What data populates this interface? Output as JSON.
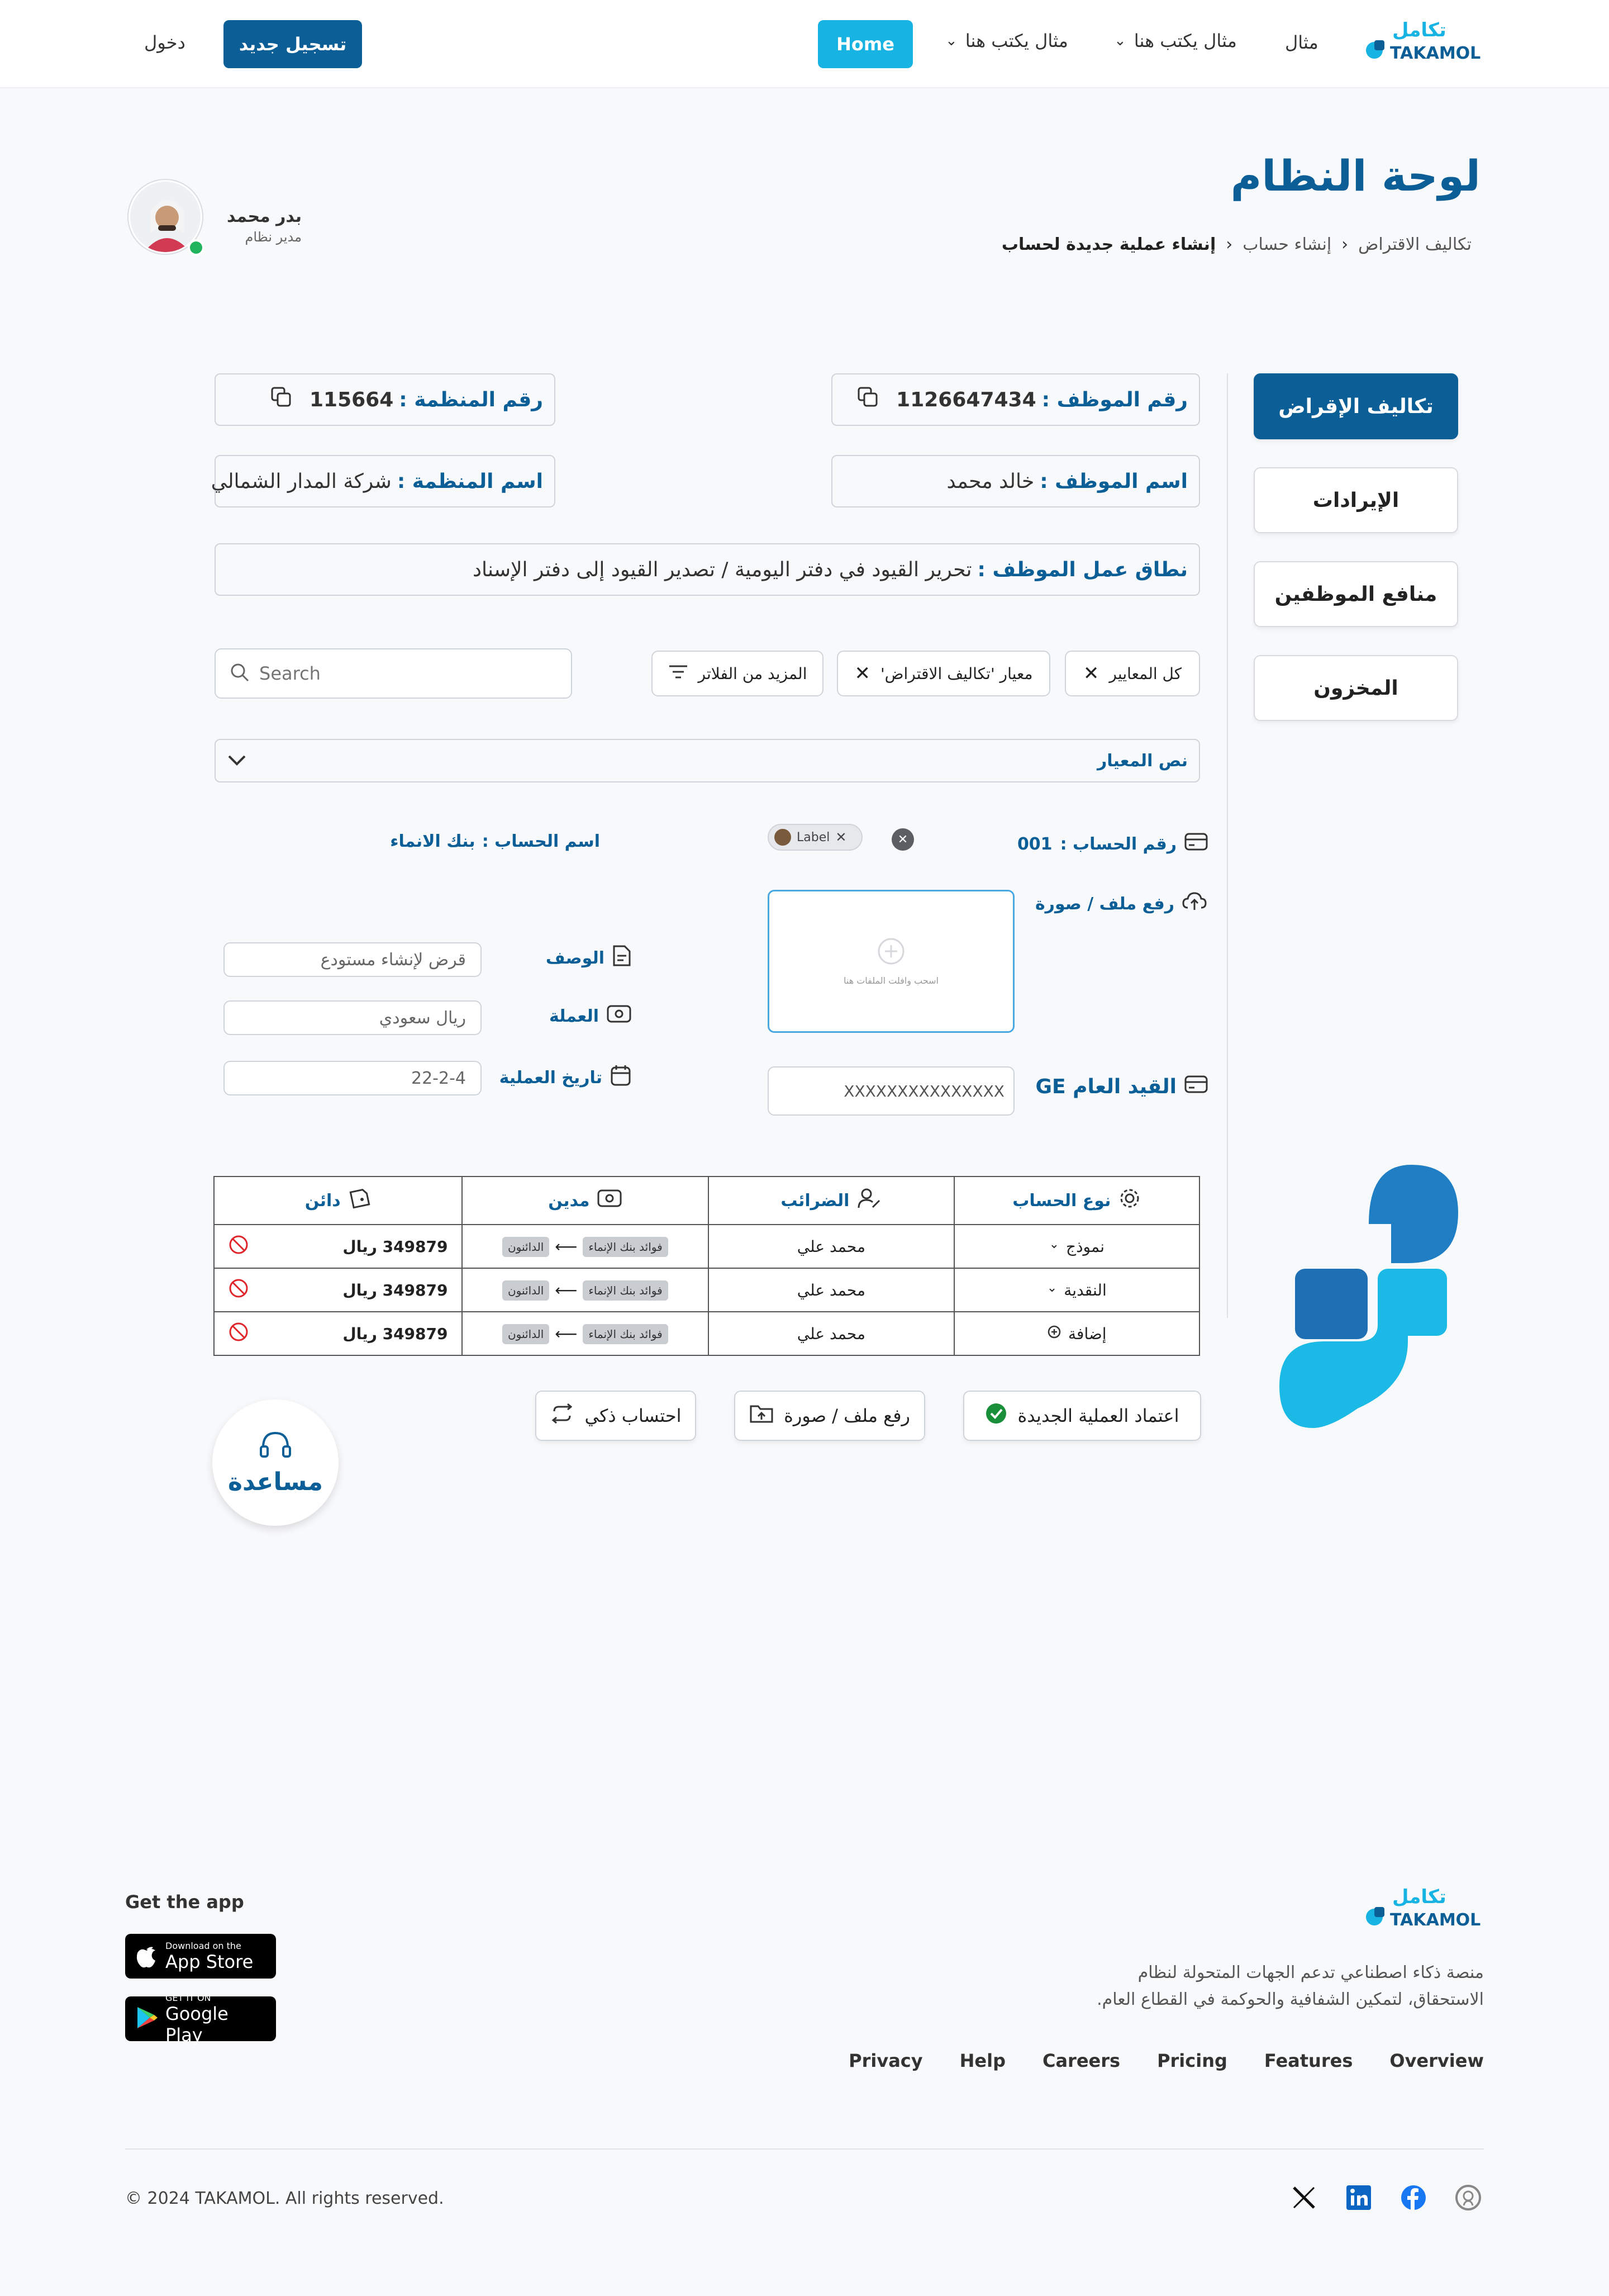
{
  "header": {
    "logo_ar": "تكامل",
    "logo_en": "TAKAMOL",
    "nav": [
      "مثال",
      "مثال يكتب هنا",
      "مثال يكتب هنا"
    ],
    "home": "Home",
    "register": "تسجيل جديد",
    "login": "دخول"
  },
  "page": {
    "title": "لوحة النظام",
    "breadcrumb": [
      "تكاليف الاقتراض",
      "إنشاء حساب",
      "إنشاء عملية جديدة لحساب"
    ]
  },
  "user": {
    "name": "بدر محمد",
    "role": "مدير نظام",
    "status_color": "#22b35e"
  },
  "sidebar": [
    "تكاليف الإقراض",
    "الإيرادات",
    "منافع الموظفين",
    "المخزون"
  ],
  "info": {
    "emp_no_label": "رقم الموظف :",
    "emp_no": "1126647434",
    "org_no_label": "رقم المنظمة :",
    "org_no": "115664",
    "emp_name_label": "اسم الموظف :",
    "emp_name": "خالد محمد",
    "org_name_label": "اسم المنظمة :",
    "org_name": "شركة المدار الشمالي",
    "scope_label": "نطاق عمل الموظف :",
    "scope": "تحرير القيود في دفتر اليومية / تصدير القيود إلى دفتر الإسناد"
  },
  "filters": {
    "all": "كل المعايير",
    "criterion": "معيار 'تكاليف الاقتراض'",
    "more": "المزيد من الفلاتر",
    "search_placeholder": "Search"
  },
  "criterion_text": "نص المعيار",
  "form": {
    "account_no_label": "رقم الحساب :",
    "account_no": "001",
    "tag_label": "Label",
    "account_name_label": "اسم  الحساب :",
    "account_name": "بنك الانماء",
    "upload_label": "رفع ملف / صورة",
    "upload_hint": "اسحب وافلت الملفات هنا",
    "desc_label": "الوصف",
    "desc_value": "قرض لإنشاء مستودع",
    "currency_label": "العملة",
    "currency_value": "ريال سعودي",
    "date_label": "تاريخ العملية",
    "date_value": "22-2-4",
    "ge_label": "القيد العام GE",
    "ge_value": "XXXXXXXXXXXXXXX"
  },
  "table": {
    "headers": [
      "نوع الحساب",
      "الضرائب",
      "مدين",
      "دائن"
    ],
    "rows": [
      {
        "type": "نموذج",
        "tax": "محمد علي",
        "debit_from": "الدائنون",
        "debit_to": "فوائد بنك الإنماء",
        "credit": "349879 ريال"
      },
      {
        "type": "النقدية",
        "tax": "محمد علي",
        "debit_from": "الدائنون",
        "debit_to": "فوائد بنك الإنماء",
        "credit": "349879 ريال"
      },
      {
        "type": "إضافة",
        "tax": "محمد علي",
        "debit_from": "الدائنون",
        "debit_to": "فوائد بنك الإنماء",
        "credit": "349879 ريال"
      }
    ]
  },
  "actions": {
    "approve": "اعتماد العملية الجديدة",
    "upload": "رفع ملف / صورة",
    "smart": "احتساب ذكي"
  },
  "help": "مساعدة",
  "footer": {
    "get_app": "Get the app",
    "appstore_small": "Download on the",
    "appstore": "App Store",
    "gplay_small": "GET IT ON",
    "gplay": "Google Play",
    "desc1": "منصة ذكاء اصطناعي تدعم الجهات المتحولة لنظام",
    "desc2": "الاستحقاق، لتمكين الشفافية والحوكمة في القطاع العام.",
    "links": [
      "Overview",
      "Features",
      "Pricing",
      "Careers",
      "Help",
      "Privacy"
    ],
    "copyright": "© 2024 TAKAMOL. All rights reserved."
  },
  "colors": {
    "primary": "#0b5e96",
    "accent": "#17b3e3",
    "danger": "#e0262a",
    "success": "#1a8f3a"
  }
}
